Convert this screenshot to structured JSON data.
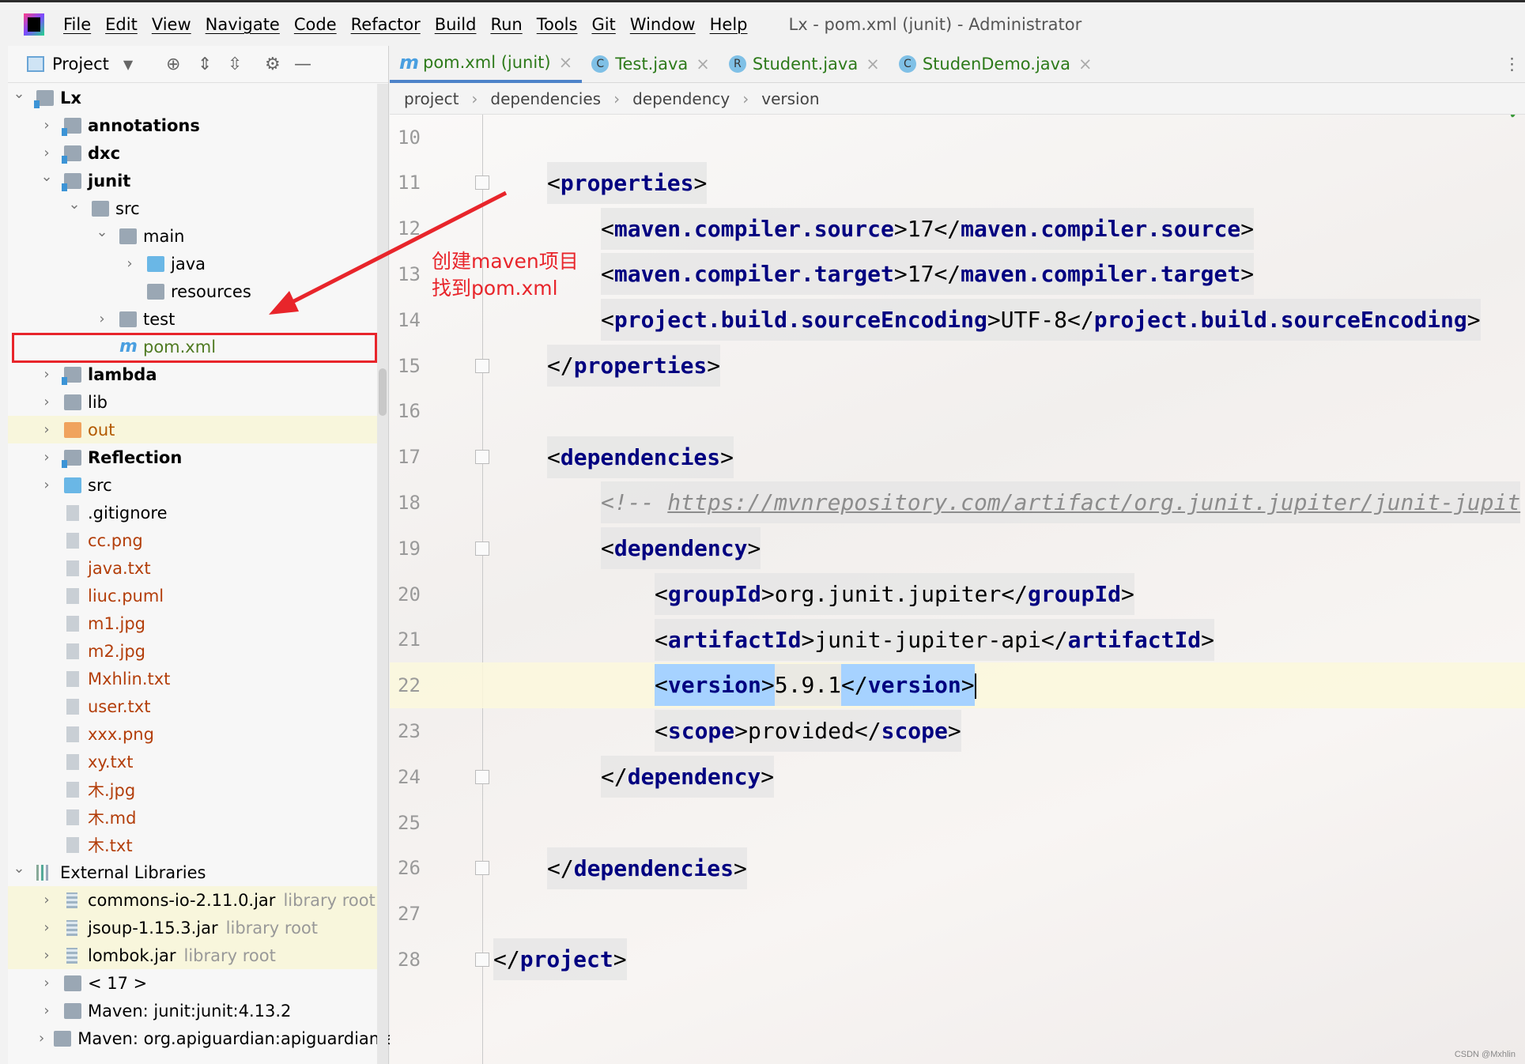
{
  "menu": {
    "items": [
      "File",
      "Edit",
      "View",
      "Navigate",
      "Code",
      "Refactor",
      "Build",
      "Run",
      "Tools",
      "Git",
      "Window",
      "Help"
    ],
    "window_title": "Lx - pom.xml (junit) - Administrator"
  },
  "sidebar": {
    "title": "Project",
    "tree": [
      {
        "label": "Lx",
        "depth": 0,
        "chev": "open",
        "icon": "folder module",
        "bold": true
      },
      {
        "label": "annotations",
        "depth": 1,
        "chev": "closed",
        "icon": "folder module",
        "bold": true
      },
      {
        "label": "dxc",
        "depth": 1,
        "chev": "closed",
        "icon": "folder module",
        "bold": true
      },
      {
        "label": "junit",
        "depth": 1,
        "chev": "open",
        "icon": "folder module",
        "bold": true
      },
      {
        "label": "src",
        "depth": 2,
        "chev": "open",
        "icon": "folder"
      },
      {
        "label": "main",
        "depth": 3,
        "chev": "open",
        "icon": "folder"
      },
      {
        "label": "java",
        "depth": 4,
        "chev": "closed",
        "icon": "folder blue"
      },
      {
        "label": "resources",
        "depth": 4,
        "chev": "none",
        "icon": "folder"
      },
      {
        "label": "test",
        "depth": 3,
        "chev": "closed",
        "icon": "folder"
      },
      {
        "label": "pom.xml",
        "depth": 3,
        "chev": "none",
        "icon": "maven",
        "color": "#4f7a22",
        "selected": true
      },
      {
        "label": "lambda",
        "depth": 1,
        "chev": "closed",
        "icon": "folder module",
        "bold": true
      },
      {
        "label": "lib",
        "depth": 1,
        "chev": "closed",
        "icon": "folder"
      },
      {
        "label": "out",
        "depth": 1,
        "chev": "closed",
        "icon": "folder orange",
        "color": "#b35a00",
        "highlight": true
      },
      {
        "label": "Reflection",
        "depth": 1,
        "chev": "closed",
        "icon": "folder module",
        "bold": true
      },
      {
        "label": "src",
        "depth": 1,
        "chev": "closed",
        "icon": "folder blue"
      },
      {
        "label": ".gitignore",
        "depth": 1,
        "chev": "none",
        "icon": "file"
      },
      {
        "label": "cc.png",
        "depth": 1,
        "chev": "none",
        "icon": "file",
        "color": "#b33e0a"
      },
      {
        "label": "java.txt",
        "depth": 1,
        "chev": "none",
        "icon": "file",
        "color": "#b33e0a"
      },
      {
        "label": "liuc.puml",
        "depth": 1,
        "chev": "none",
        "icon": "file",
        "color": "#b33e0a"
      },
      {
        "label": "m1.jpg",
        "depth": 1,
        "chev": "none",
        "icon": "file",
        "color": "#b33e0a"
      },
      {
        "label": "m2.jpg",
        "depth": 1,
        "chev": "none",
        "icon": "file",
        "color": "#b33e0a"
      },
      {
        "label": "Mxhlin.txt",
        "depth": 1,
        "chev": "none",
        "icon": "file",
        "color": "#b33e0a"
      },
      {
        "label": "user.txt",
        "depth": 1,
        "chev": "none",
        "icon": "file",
        "color": "#b33e0a"
      },
      {
        "label": "xxx.png",
        "depth": 1,
        "chev": "none",
        "icon": "file",
        "color": "#b33e0a"
      },
      {
        "label": "xy.txt",
        "depth": 1,
        "chev": "none",
        "icon": "file",
        "color": "#b33e0a"
      },
      {
        "label": "木.jpg",
        "depth": 1,
        "chev": "none",
        "icon": "file",
        "color": "#b33e0a"
      },
      {
        "label": "木.md",
        "depth": 1,
        "chev": "none",
        "icon": "file",
        "color": "#b33e0a"
      },
      {
        "label": "木.txt",
        "depth": 1,
        "chev": "none",
        "icon": "file",
        "color": "#b33e0a"
      },
      {
        "label": "External Libraries",
        "depth": 0,
        "chev": "open",
        "icon": "lib"
      },
      {
        "label": "commons-io-2.11.0.jar",
        "depth": 1,
        "chev": "closed",
        "icon": "jar",
        "suffix": "library root",
        "highlight": true
      },
      {
        "label": "jsoup-1.15.3.jar",
        "depth": 1,
        "chev": "closed",
        "icon": "jar",
        "suffix": "library root",
        "highlight": true
      },
      {
        "label": "lombok.jar",
        "depth": 1,
        "chev": "closed",
        "icon": "jar",
        "suffix": "library root",
        "highlight": true
      },
      {
        "label": "< 17 >",
        "depth": 1,
        "chev": "closed",
        "icon": "folder"
      },
      {
        "label": "Maven: junit:junit:4.13.2",
        "depth": 1,
        "chev": "closed",
        "icon": "folder"
      },
      {
        "label": "Maven: org.apiguardian:apiguardian-api",
        "depth": 1,
        "chev": "closed",
        "icon": "folder"
      }
    ]
  },
  "tabs": [
    {
      "label": "pom.xml (junit)",
      "icon": "m",
      "active": true
    },
    {
      "label": "Test.java",
      "icon": "C"
    },
    {
      "label": "Student.java",
      "icon": "R"
    },
    {
      "label": "StudenDemo.java",
      "icon": "C"
    }
  ],
  "breadcrumbs": [
    "project",
    "dependencies",
    "dependency",
    "version"
  ],
  "editor": {
    "current_line": "22",
    "lines": [
      {
        "n": "10",
        "indent": 0,
        "tokens": []
      },
      {
        "n": "11",
        "indent": 1,
        "fold": true,
        "tokens": [
          "<",
          "properties",
          ">"
        ]
      },
      {
        "n": "12",
        "indent": 2,
        "tokens": [
          "<",
          "maven.compiler.source",
          ">",
          "17",
          "</",
          "maven.compiler.source",
          ">"
        ]
      },
      {
        "n": "13",
        "indent": 2,
        "tokens": [
          "<",
          "maven.compiler.target",
          ">",
          "17",
          "</",
          "maven.compiler.target",
          ">"
        ]
      },
      {
        "n": "14",
        "indent": 2,
        "tokens": [
          "<",
          "project.build.sourceEncoding",
          ">",
          "UTF-8",
          "</",
          "project.build.sourceEncoding",
          ">"
        ]
      },
      {
        "n": "15",
        "indent": 1,
        "fold": true,
        "tokens": [
          "</",
          "properties",
          ">"
        ]
      },
      {
        "n": "16",
        "indent": 0,
        "tokens": []
      },
      {
        "n": "17",
        "indent": 1,
        "fold": true,
        "tokens": [
          "<",
          "dependencies",
          ">"
        ]
      },
      {
        "n": "18",
        "indent": 2,
        "comment": true,
        "tokens": [
          "<!-- ",
          "https://mvnrepository.com/artifact/org.junit.jupiter/junit-jupit"
        ]
      },
      {
        "n": "19",
        "indent": 2,
        "fold": true,
        "tokens": [
          "<",
          "dependency",
          ">"
        ]
      },
      {
        "n": "20",
        "indent": 3,
        "tokens": [
          "<",
          "groupId",
          ">",
          "org.junit.jupiter",
          "</",
          "groupId",
          ">"
        ]
      },
      {
        "n": "21",
        "indent": 3,
        "tokens": [
          "<",
          "artifactId",
          ">",
          "junit-jupiter-api",
          "</",
          "artifactId",
          ">"
        ]
      },
      {
        "n": "22",
        "indent": 3,
        "selected_tags": true,
        "tokens": [
          "<",
          "version",
          ">",
          "5.9.1",
          "</",
          "version",
          ">"
        ]
      },
      {
        "n": "23",
        "indent": 3,
        "tokens": [
          "<",
          "scope",
          ">",
          "provided",
          "</",
          "scope",
          ">"
        ]
      },
      {
        "n": "24",
        "indent": 2,
        "fold": true,
        "tokens": [
          "</",
          "dependency",
          ">"
        ]
      },
      {
        "n": "25",
        "indent": 0,
        "tokens": []
      },
      {
        "n": "26",
        "indent": 1,
        "fold": true,
        "tokens": [
          "</",
          "dependencies",
          ">"
        ]
      },
      {
        "n": "27",
        "indent": 0,
        "tokens": []
      },
      {
        "n": "28",
        "indent": 0,
        "fold": true,
        "tokens": [
          "</",
          "project",
          ">"
        ]
      }
    ]
  },
  "annotation": {
    "line1": "创建maven项目",
    "line2": "找到pom.xml",
    "color": "#e8252b"
  },
  "watermark": "CSDN @Mxhlin",
  "colors": {
    "tag": "#000080",
    "selection": "#a6d2ff",
    "current_line": "#fcf8dc",
    "accent": "#4d83c9"
  }
}
